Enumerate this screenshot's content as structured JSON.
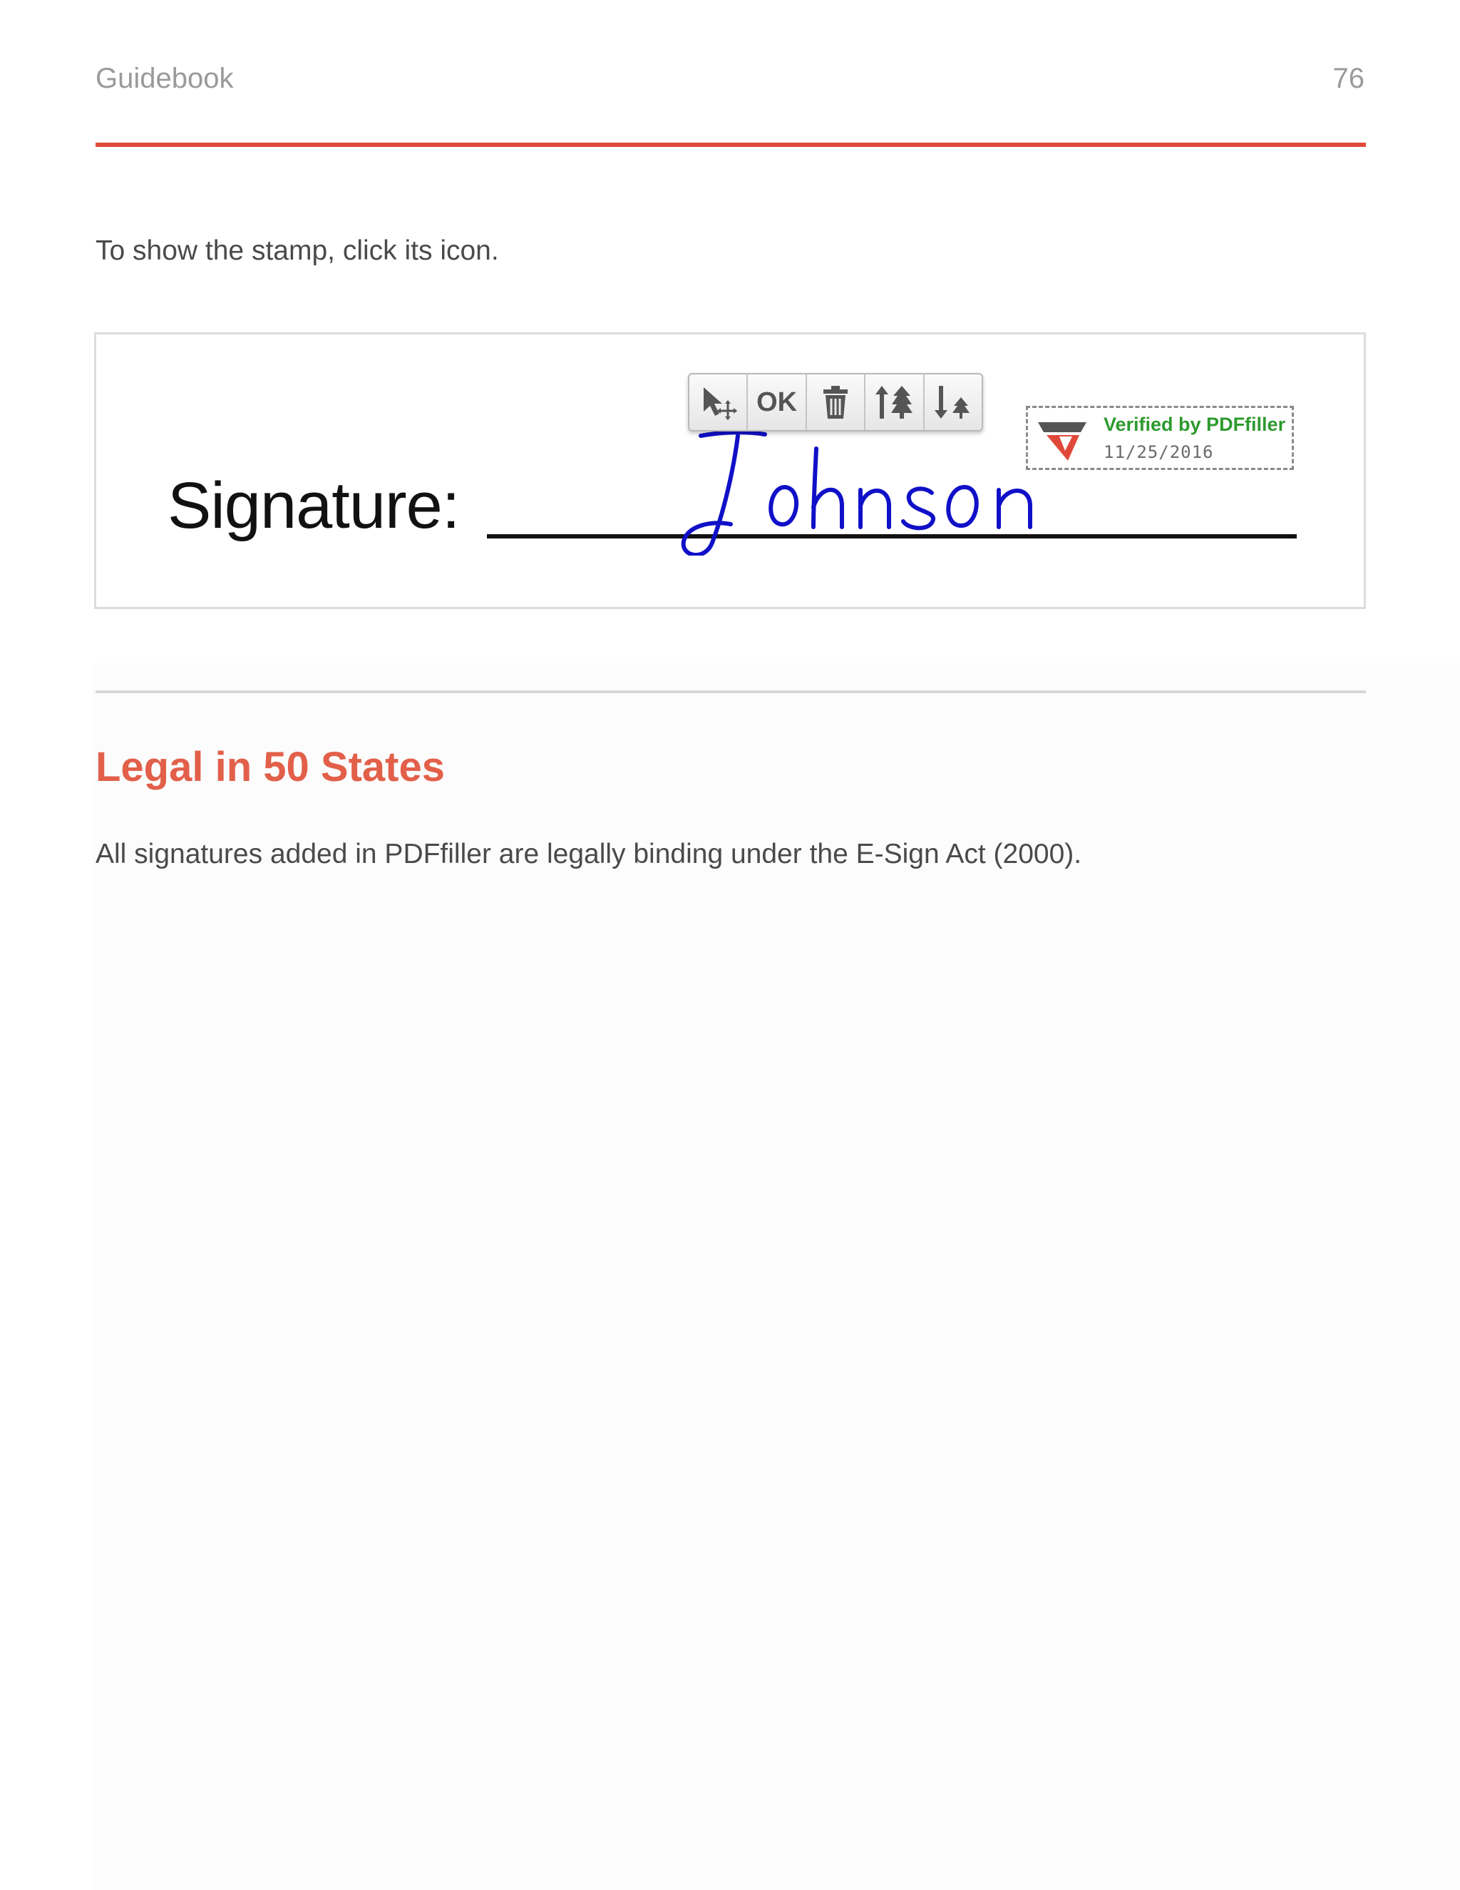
{
  "header": {
    "title": "Guidebook",
    "page_number": "76",
    "accent_color": "#e0493a"
  },
  "intro": {
    "text": "To show the stamp, click its icon."
  },
  "figure": {
    "signature_label": "Signature:",
    "signature_handwriting": "Johnson",
    "signature_ink_color": "#1010c8",
    "toolbar": {
      "buttons": [
        {
          "icon": "move-cursor-icon"
        },
        {
          "label": "OK"
        },
        {
          "icon": "trash-icon"
        },
        {
          "icon": "bring-forward-icon"
        },
        {
          "icon": "send-backward-icon"
        }
      ]
    },
    "stamp": {
      "logo_icon": "pdffiller-logo-icon",
      "verified_text": "Verified by PDFfiller",
      "date": "11/25/2016",
      "verified_color": "#2e9a2e"
    }
  },
  "section": {
    "heading": "Legal in 50 States",
    "heading_color": "#e2604a",
    "body": "All signatures added in PDFfiller are legally binding under the E-Sign Act (2000)."
  }
}
